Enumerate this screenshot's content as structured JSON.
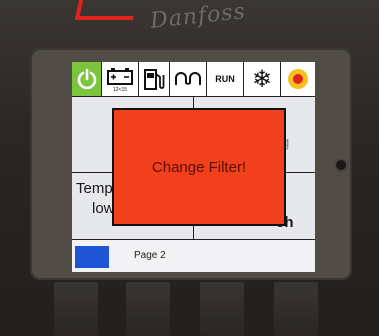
{
  "device": {
    "brand_logo": "Danfoss"
  },
  "icon_bar": {
    "battery_caption": "12<15",
    "run_label": "RUN",
    "snowflake_glyph": "❄"
  },
  "status_screen": {
    "cell_temp_label": "Temp",
    "cell_temp_value": "low",
    "cell_hours_suffix": "5h",
    "cell_partial_glyph": "g"
  },
  "bottom_bar": {
    "page_label": "Page 2"
  },
  "alert": {
    "message": "Change Filter!"
  },
  "colors": {
    "power_active": "#7cc43c",
    "alert_background": "#f0411c",
    "page_button": "#1d55d6",
    "alarm_ring": "#f4c21a",
    "alarm_core": "#e0241c"
  }
}
